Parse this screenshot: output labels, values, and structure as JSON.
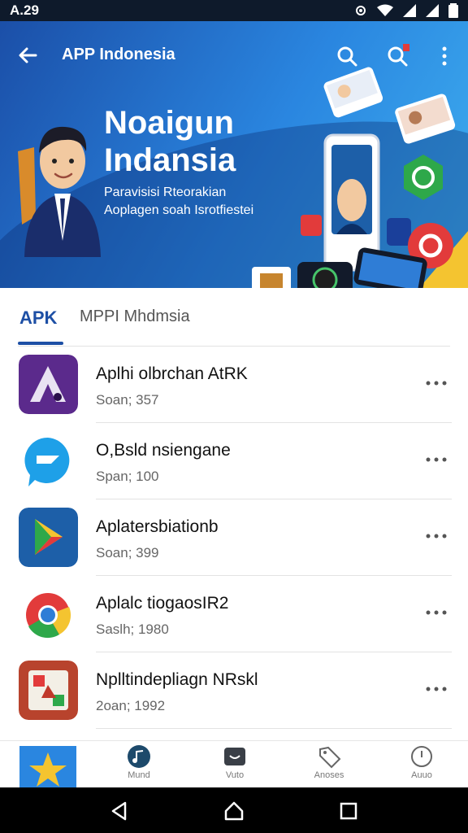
{
  "status_bar": {
    "time": "A.29",
    "icons": [
      "settings-icon",
      "wifi-icon",
      "signal-icon",
      "signal-icon",
      "battery-icon"
    ]
  },
  "header": {
    "title": "APP Indonesia",
    "icons": [
      "back-arrow-icon",
      "search-icon",
      "search-icon",
      "more-vertical-icon"
    ]
  },
  "hero": {
    "heading_line1": "Noaigun",
    "heading_line2": "Indansia",
    "sub_line1": "Paravisisi Rteorakian",
    "sub_line2": "Aoplagen soah Isrotfiestei"
  },
  "tabs": {
    "active": "APK",
    "other": "MPPI Mhdmsia"
  },
  "apps": [
    {
      "name": "Aplhi olbrchan AtRK",
      "meta": "Soan; 357",
      "icon": "purple-a-app-icon",
      "color": "#5b2a8c"
    },
    {
      "name": "O,Bsld nsiengane",
      "meta": "Span; 100",
      "icon": "chat-bubble-app-icon",
      "color": "#1ea0e8"
    },
    {
      "name": "Aplatersbiationb",
      "meta": "Soan; 399",
      "icon": "play-store-app-icon",
      "color": "#1d5fa8"
    },
    {
      "name": "Aplalc tiogaosIR2",
      "meta": "Saslh; 1980",
      "icon": "chrome-app-icon",
      "color": "#ffffff"
    },
    {
      "name": "Nplltindepliagn NRskl",
      "meta": "2oan; 1992",
      "icon": "photo-app-icon",
      "color": "#c0392b"
    }
  ],
  "bottom_nav": [
    {
      "label": "",
      "icon": "star-app-icon"
    },
    {
      "label": "Mund",
      "icon": "music-icon"
    },
    {
      "label": "Vuto",
      "icon": "game-controller-icon"
    },
    {
      "label": "Anoses",
      "icon": "tag-icon"
    },
    {
      "label": "Auuo",
      "icon": "clock-icon"
    }
  ],
  "system_nav": [
    "back-triangle-icon",
    "home-icon",
    "recents-square-icon"
  ]
}
